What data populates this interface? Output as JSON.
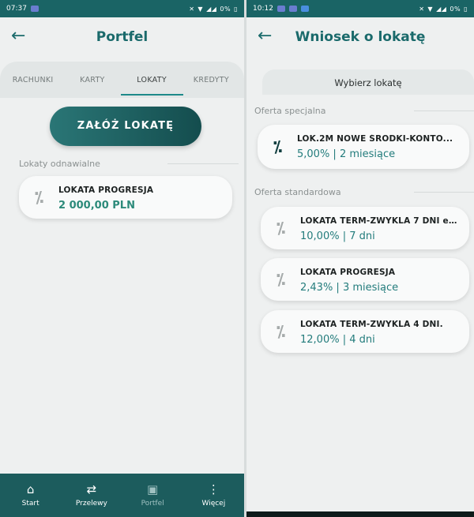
{
  "left": {
    "status": {
      "time": "07:37",
      "battery": "0%"
    },
    "title": "Portfel",
    "tabs": [
      {
        "label": "RACHUNKI",
        "active": false
      },
      {
        "label": "KARTY",
        "active": false
      },
      {
        "label": "LOKATY",
        "active": true
      },
      {
        "label": "KREDYTY",
        "active": false
      }
    ],
    "cta_label": "ZAŁÓŻ LOKATĘ",
    "section_label": "Lokaty odnawialne",
    "deposit": {
      "name": "LOKATA PROGRESJA",
      "amount": "2 000,00 PLN"
    },
    "nav": [
      {
        "label": "Start",
        "icon": "home-icon"
      },
      {
        "label": "Przelewy",
        "icon": "transfer-icon"
      },
      {
        "label": "Portfel",
        "icon": "wallet-icon",
        "active": true
      },
      {
        "label": "Więcej",
        "icon": "more-vertical-icon"
      }
    ]
  },
  "right": {
    "status": {
      "time": "10:12",
      "battery": "0%"
    },
    "title": "Wniosek o lokatę",
    "subheader": "Wybierz lokatę",
    "special_label": "Oferta specjalna",
    "special_offer": {
      "name": "LOK.2M NOWE ŚRODKI-KONTO...",
      "rate": "5,00% | 2 miesiące"
    },
    "standard_label": "Oferta standardowa",
    "standard_offers": [
      {
        "name": "LOKATA TERM-ZWYKLA 7 DNI eu...",
        "rate": "10,00% | 7 dni"
      },
      {
        "name": "LOKATA PROGRESJA",
        "rate": "2,43% | 3 miesiące"
      },
      {
        "name": "LOKATA TERM-ZWYKLA 4 DNI.",
        "rate": "12,00% | 4 dni"
      }
    ]
  },
  "colors": {
    "primary": "#1a6465",
    "accent": "#2c8a7a",
    "background": "#eef0f0"
  }
}
